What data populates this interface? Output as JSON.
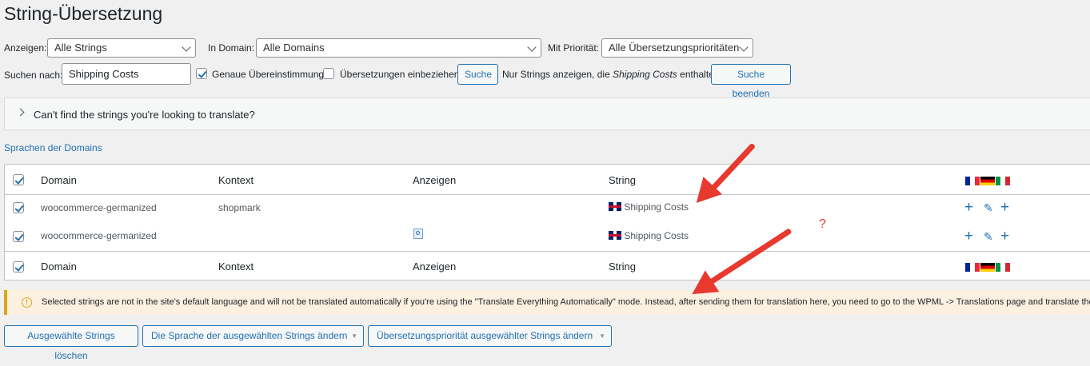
{
  "page": {
    "title": "String-Übersetzung"
  },
  "filters": {
    "show_label": "Anzeigen:",
    "show_value": "Alle Strings",
    "domain_label": "In Domain:",
    "domain_value": "Alle Domains",
    "priority_label": "Mit Priorität:",
    "priority_value": "Alle Übersetzungsprioritäten",
    "search_label": "Suchen nach:",
    "search_value": "Shipping Costs",
    "exact_label": "Genaue Übereinstimmung",
    "exact_checked": true,
    "translations_label": "Übersetzungen einbeziehen",
    "translations_checked": false,
    "search_button": "Suche",
    "result_prefix": "Nur Strings anzeigen, die",
    "result_term": "Shipping Costs",
    "result_suffix": "enthalten",
    "end_search_button": "Suche beenden"
  },
  "help_panel": {
    "text": "Can't find the strings you're looking to translate?"
  },
  "domains_link": "Sprachen der Domains",
  "table": {
    "columns": {
      "domain": "Domain",
      "context": "Kontext",
      "show": "Anzeigen",
      "string": "String"
    },
    "rows": [
      {
        "domain": "woocommerce-germanized",
        "context": "shopmark",
        "string": "Shipping Costs",
        "has_view_icon": false
      },
      {
        "domain": "woocommerce-germanized",
        "context": "",
        "string": "Shipping Costs",
        "has_view_icon": true
      }
    ]
  },
  "notice": {
    "text": "Selected strings are not in the site's default language and will not be translated automatically if you're using the \"Translate Everything Automatically\" mode. Instead, after sending them for translation here, you need to go to the WPML -> Translations page and translate them ma"
  },
  "bulk_actions": {
    "delete": "Ausgewählte Strings löschen",
    "language": "Die Sprache der ausgewählten Strings ändern",
    "priority": "Übersetzungspriorität ausgewählter Strings ändern"
  },
  "annotation": {
    "question_mark": "?"
  },
  "colors": {
    "accent": "#2271b1",
    "arrow": "#e8392f",
    "notice_border": "#dba617"
  }
}
